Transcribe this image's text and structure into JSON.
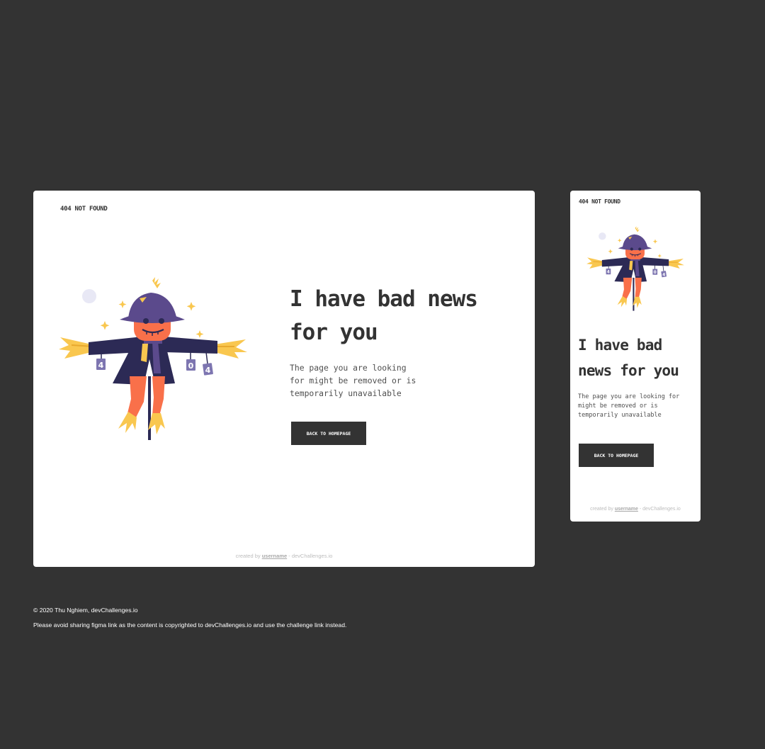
{
  "page": {
    "background": "#333333",
    "card_background": "#ffffff",
    "button_color": "#333333"
  },
  "desktop": {
    "brand": "404 NOT FOUND",
    "headline": "I have bad news for you",
    "description": "The page you are looking for might be removed or is temporarily unavailable",
    "button_label": "BACK TO HOMEPAGE",
    "credit": {
      "prefix": "created by ",
      "username": "username",
      "suffix": " - devChallenges.io"
    }
  },
  "mobile": {
    "brand": "404 NOT FOUND",
    "headline": "I have bad news for you",
    "description": "The page you are looking for might be removed or is temporarily unavailable",
    "button_label": "BACK TO HOMEPAGE",
    "credit": {
      "prefix": "created by ",
      "username": "username",
      "suffix": " - devChallenges.io"
    }
  },
  "illustration": {
    "icon": "scarecrow-illustration",
    "sign_digits": [
      "4",
      "0",
      "4"
    ],
    "colors": {
      "hat": "#5b4a8c",
      "coat": "#2c2a55",
      "face": "#f9704a",
      "straw": "#f9c74f",
      "pants": "#f9704a",
      "tag": "#7d75b0",
      "moon": "#e8e8f5"
    }
  },
  "footer": {
    "copyright": "© 2020 Thu Nghiem, devChallenges.io",
    "notice": "Please avoid sharing figma link as the content is copyrighted to devChallenges.io and use the challenge link instead."
  }
}
